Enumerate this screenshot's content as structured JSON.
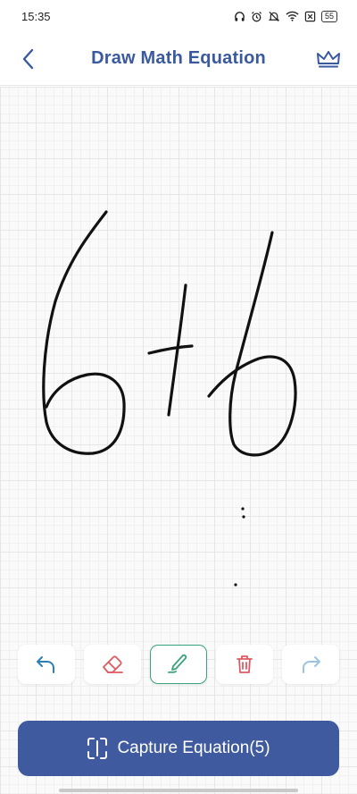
{
  "status": {
    "time": "15:35",
    "battery": "55",
    "icons": [
      "headphones-icon",
      "alarm-icon",
      "mute-icon",
      "wifi-icon",
      "sim-icon",
      "battery-icon"
    ]
  },
  "header": {
    "title": "Draw Math Equation",
    "back_icon": "chevron-left-icon",
    "premium_icon": "crown-icon"
  },
  "toolbar": {
    "tools": [
      {
        "name": "undo",
        "icon": "undo-icon",
        "color": "#2f7fb5"
      },
      {
        "name": "eraser",
        "icon": "eraser-icon",
        "color": "#e05a63"
      },
      {
        "name": "pen",
        "icon": "pen-icon",
        "color": "#3aa37a",
        "active": true
      },
      {
        "name": "clear",
        "icon": "trash-icon",
        "color": "#e05a63"
      },
      {
        "name": "redo",
        "icon": "redo-icon",
        "color": "#9cc4e0"
      }
    ]
  },
  "capture": {
    "label": "Capture Equation(5)",
    "icon": "scan-frame-icon"
  },
  "colors": {
    "brand": "#3f5a9f",
    "title": "#3a5aa0",
    "active_tool": "#3aa37a"
  }
}
